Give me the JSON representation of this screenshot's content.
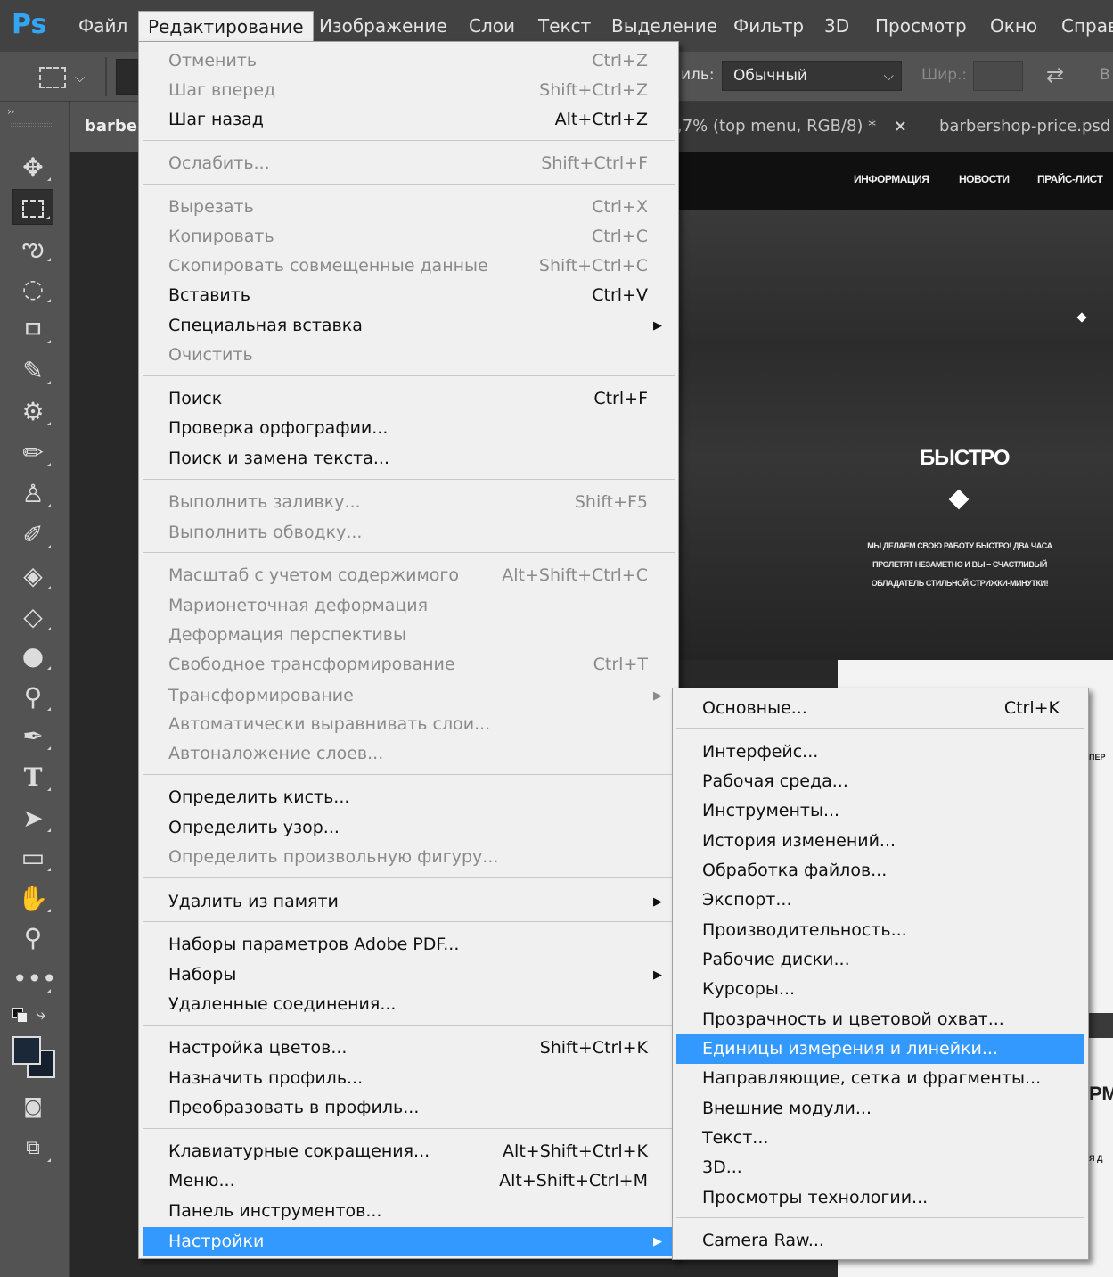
{
  "app": {
    "logo": "Ps"
  },
  "menubar": {
    "items": [
      "Файл",
      "Редактирование",
      "Изображение",
      "Слои",
      "Текст",
      "Выделение",
      "Фильтр",
      "3D",
      "Просмотр",
      "Окно",
      "Справ"
    ]
  },
  "options": {
    "style_label": "иль:",
    "style_value": "Обычный",
    "width_label": "Шир.:",
    "edge_text": "В"
  },
  "tabs": {
    "tab1": "barber",
    "tab2": ",7% (top menu, RGB/8) *",
    "close_glyph": "×",
    "tab3": "barbershop-price.psd"
  },
  "tools": {
    "panel_head": "››",
    "items": [
      "move-tool",
      "rectangular-marquee-tool",
      "lasso-tool",
      "quick-selection-tool",
      "crop-tool",
      "eyedropper-tool",
      "spot-healing-tool",
      "brush-tool",
      "clone-stamp-tool",
      "history-brush-tool",
      "eraser-tool",
      "paint-bucket-tool",
      "blur-tool",
      "dodge-tool",
      "pen-tool",
      "type-tool",
      "path-selection-tool",
      "rectangle-tool",
      "hand-tool",
      "zoom-tool",
      "more-tools",
      "quick-mask",
      "screen-mode"
    ],
    "foreground_color": "#1b2838",
    "background_color": "#14202e"
  },
  "canvas": {
    "nav": [
      "ИНФОРМАЦИЯ",
      "НОВОСТИ",
      "ПРАЙС-ЛИСТ"
    ],
    "hero_title": "БЫСТРО",
    "hero_lines": [
      "МЫ ДЕЛАЕМ СВОЮ РАБОТУ БЫСТРО! ДВА ЧАСА",
      "ПРОЛЕТЯТ НЕЗАМЕТНО И ВЫ – СЧАСТЛИВЫЙ",
      "ОБЛАДАТЕЛЬ СТИЛЬНОЙ СТРИЖКИ-МИНУТКИ!"
    ],
    "frag_1": "ПЕР",
    "frag_2": "РМ",
    "frag_3": "Я Д"
  },
  "edit_menu": {
    "items": [
      {
        "label": "Отменить",
        "shortcut": "Ctrl+Z",
        "disabled": true
      },
      {
        "label": "Шаг вперед",
        "shortcut": "Shift+Ctrl+Z",
        "disabled": true
      },
      {
        "label": "Шаг назад",
        "shortcut": "Alt+Ctrl+Z",
        "disabled": false
      },
      {
        "label": "Ослабить...",
        "shortcut": "Shift+Ctrl+F",
        "disabled": true
      },
      {
        "label": "Вырезать",
        "shortcut": "Ctrl+X",
        "disabled": true
      },
      {
        "label": "Копировать",
        "shortcut": "Ctrl+C",
        "disabled": true
      },
      {
        "label": "Скопировать совмещенные данные",
        "shortcut": "Shift+Ctrl+C",
        "disabled": true
      },
      {
        "label": "Вставить",
        "shortcut": "Ctrl+V",
        "disabled": false
      },
      {
        "label": "Специальная вставка",
        "shortcut": "",
        "disabled": false
      },
      {
        "label": "Очистить",
        "shortcut": "",
        "disabled": true
      },
      {
        "label": "Поиск",
        "shortcut": "Ctrl+F",
        "disabled": false
      },
      {
        "label": "Проверка орфографии...",
        "shortcut": "",
        "disabled": false
      },
      {
        "label": "Поиск и замена текста...",
        "shortcut": "",
        "disabled": false
      },
      {
        "label": "Выполнить заливку...",
        "shortcut": "Shift+F5",
        "disabled": true
      },
      {
        "label": "Выполнить обводку...",
        "shortcut": "",
        "disabled": true
      },
      {
        "label": "Масштаб с учетом содержимого",
        "shortcut": "Alt+Shift+Ctrl+C",
        "disabled": true
      },
      {
        "label": "Марионеточная деформация",
        "shortcut": "",
        "disabled": true
      },
      {
        "label": "Деформация перспективы",
        "shortcut": "",
        "disabled": true
      },
      {
        "label": "Свободное трансформирование",
        "shortcut": "Ctrl+T",
        "disabled": true
      },
      {
        "label": "Трансформирование",
        "shortcut": "",
        "disabled": true
      },
      {
        "label": "Автоматически выравнивать слои...",
        "shortcut": "",
        "disabled": true
      },
      {
        "label": "Автоналожение слоев...",
        "shortcut": "",
        "disabled": true
      },
      {
        "label": "Определить кисть...",
        "shortcut": "",
        "disabled": false
      },
      {
        "label": "Определить узор...",
        "shortcut": "",
        "disabled": false
      },
      {
        "label": "Определить произвольную фигуру...",
        "shortcut": "",
        "disabled": true
      },
      {
        "label": "Удалить из памяти",
        "shortcut": "",
        "disabled": false
      },
      {
        "label": "Наборы параметров Adobe PDF...",
        "shortcut": "",
        "disabled": false
      },
      {
        "label": "Наборы",
        "shortcut": "",
        "disabled": false
      },
      {
        "label": "Удаленные соединения...",
        "shortcut": "",
        "disabled": false
      },
      {
        "label": "Настройка цветов...",
        "shortcut": "Shift+Ctrl+K",
        "disabled": false
      },
      {
        "label": "Назначить профиль...",
        "shortcut": "",
        "disabled": false
      },
      {
        "label": "Преобразовать в профиль...",
        "shortcut": "",
        "disabled": false
      },
      {
        "label": "Клавиатурные сокращения...",
        "shortcut": "Alt+Shift+Ctrl+K",
        "disabled": false
      },
      {
        "label": "Меню...",
        "shortcut": "Alt+Shift+Ctrl+M",
        "disabled": false
      },
      {
        "label": "Панель инструментов...",
        "shortcut": "",
        "disabled": false
      },
      {
        "label": "Настройки",
        "shortcut": "",
        "disabled": false
      }
    ]
  },
  "prefs_menu": {
    "items": [
      {
        "label": "Основные...",
        "shortcut": "Ctrl+K"
      },
      {
        "label": "Интерфейс...",
        "shortcut": ""
      },
      {
        "label": "Рабочая среда...",
        "shortcut": ""
      },
      {
        "label": "Инструменты...",
        "shortcut": ""
      },
      {
        "label": "История изменений...",
        "shortcut": ""
      },
      {
        "label": "Обработка файлов...",
        "shortcut": ""
      },
      {
        "label": "Экспорт...",
        "shortcut": ""
      },
      {
        "label": "Производительность...",
        "shortcut": ""
      },
      {
        "label": "Рабочие диски...",
        "shortcut": ""
      },
      {
        "label": "Курсоры...",
        "shortcut": ""
      },
      {
        "label": "Прозрачность и цветовой охват...",
        "shortcut": ""
      },
      {
        "label": "Единицы измерения и линейки...",
        "shortcut": ""
      },
      {
        "label": "Направляющие, сетка и фрагменты...",
        "shortcut": ""
      },
      {
        "label": "Внешние модули...",
        "shortcut": ""
      },
      {
        "label": "Текст...",
        "shortcut": ""
      },
      {
        "label": "3D...",
        "shortcut": ""
      },
      {
        "label": "Просмотры технологии...",
        "shortcut": ""
      },
      {
        "label": "Camera Raw...",
        "shortcut": ""
      }
    ]
  },
  "colors": {
    "highlight": "#3399ff",
    "ps_blue": "#32a6f5",
    "menu_bg": "#f0f0f0"
  }
}
